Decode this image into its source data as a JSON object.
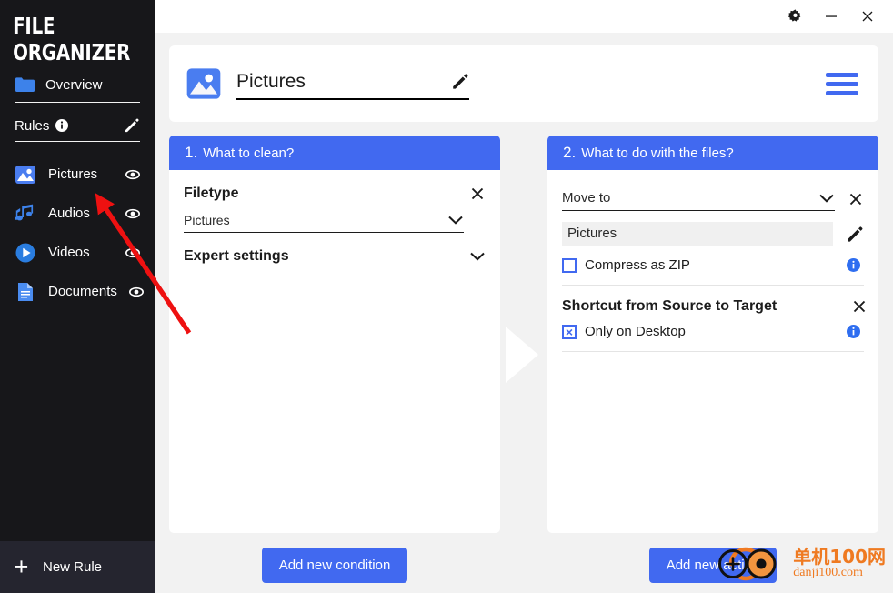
{
  "window": {
    "controls": [
      {
        "name": "settings-gear",
        "icon": "gear-icon",
        "label": ""
      },
      {
        "name": "minimize",
        "icon": "minimize-icon",
        "label": ""
      },
      {
        "name": "close",
        "icon": "close-icon",
        "label": ""
      }
    ]
  },
  "sidebar": {
    "brand": "FILE\nORGANIZER",
    "overview": {
      "label": "Overview",
      "icon": "folder-icon"
    },
    "rules_header": {
      "label": "Rules",
      "info_icon": "info-icon",
      "edit_icon": "pencil-icon"
    },
    "rules": [
      {
        "label": "Pictures",
        "icon": "image-icon",
        "visibility_icon": "eye-icon",
        "selected": true
      },
      {
        "label": "Audios",
        "icon": "music-icon",
        "visibility_icon": "eye-icon",
        "selected": false
      },
      {
        "label": "Videos",
        "icon": "video-icon",
        "visibility_icon": "eye-icon",
        "selected": false
      },
      {
        "label": "Documents",
        "icon": "document-icon",
        "visibility_icon": "eye-icon",
        "selected": false
      }
    ],
    "new_rule": {
      "label": "New Rule",
      "icon": "plus-icon"
    }
  },
  "header": {
    "rule_icon": "image-icon",
    "rule_name": "Pictures",
    "edit_icon": "pencil-icon",
    "menu_icon": "hamburger-icon"
  },
  "panel_conditions": {
    "step_number": "1.",
    "title": "What to clean?",
    "condition": {
      "title": "Filetype",
      "remove_icon": "close-icon",
      "select_value": "Pictures",
      "select_icon": "chevron-down-icon"
    },
    "expert": {
      "label": "Expert settings",
      "icon": "chevron-down-icon"
    },
    "add_button": "Add new condition"
  },
  "panel_actions": {
    "step_number": "2.",
    "title": "What to do with the files?",
    "action_move": {
      "select_value": "Move to",
      "select_icon": "chevron-down-icon",
      "remove_icon": "close-icon",
      "target_value": "Pictures",
      "edit_icon": "pencil-icon",
      "compress_label": "Compress as ZIP",
      "compress_checked": false,
      "info_icon": "info-icon"
    },
    "action_shortcut": {
      "title": "Shortcut from Source to Target",
      "remove_icon": "close-icon",
      "desktop_label": "Only on Desktop",
      "desktop_checked": true,
      "desktop_mark": "×",
      "info_icon": "info-icon"
    },
    "add_button": "Add new action"
  },
  "flow_arrow": {
    "icon": "arrow-right-icon"
  },
  "annotation": {
    "icon": "red-arrow-pointer",
    "color": "#ee1111"
  },
  "watermark": {
    "cn": "单机100网",
    "en": "danji100.com",
    "color": "#ef7a21"
  },
  "colors": {
    "accent": "#4169f0",
    "sidebar_bg": "#17171a",
    "sidebar_footer_bg": "#25252f",
    "content_bg": "#f2f2f2",
    "card_bg": "#ffffff"
  }
}
